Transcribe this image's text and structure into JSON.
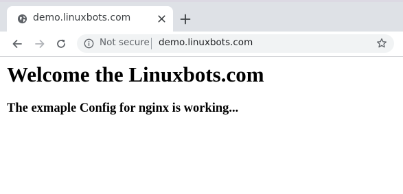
{
  "browser": {
    "tab": {
      "title": "demo.linuxbots.com",
      "favicon": "globe-icon"
    },
    "new_tab_icon": "plus-icon",
    "toolbar": {
      "back_icon": "arrow-left-icon",
      "forward_icon": "arrow-right-icon",
      "reload_icon": "reload-icon",
      "security_icon": "info-icon",
      "security_label": "Not secure",
      "url": "demo.linuxbots.com",
      "bookmark_icon": "star-icon"
    },
    "colors": {
      "tabstrip": "#dee1e6",
      "omnibox": "#f1f3f4",
      "text_primary": "#202124",
      "text_secondary": "#5f6368"
    }
  },
  "page": {
    "heading": "Welcome the Linuxbots.com",
    "subheading": "The exmaple Config for nginx is working..."
  }
}
